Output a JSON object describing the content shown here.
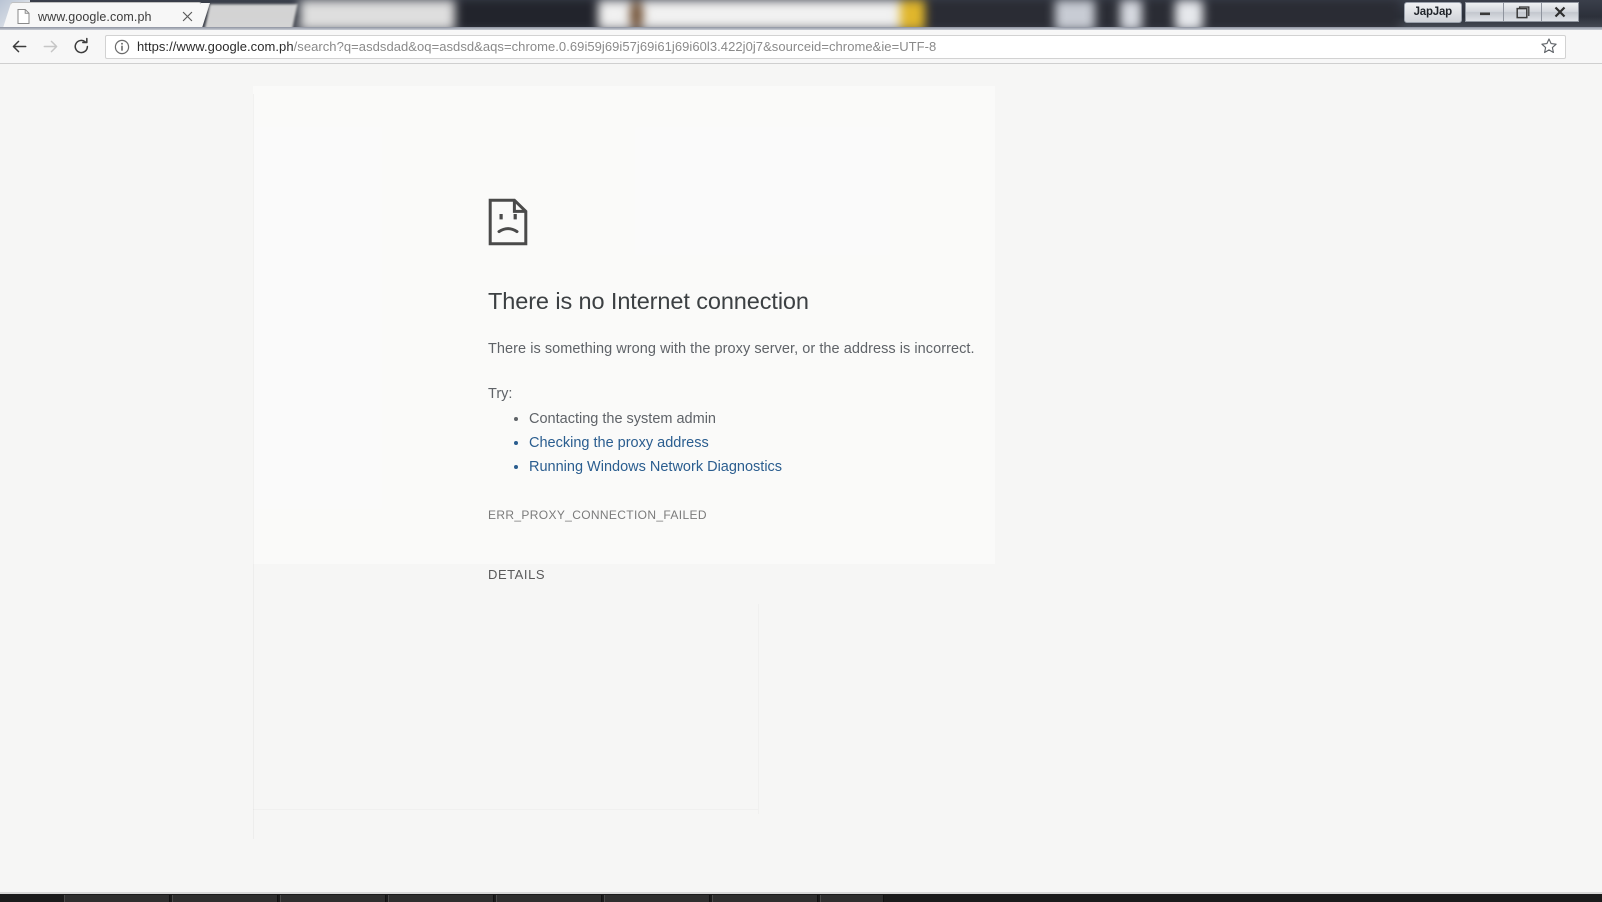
{
  "window": {
    "badge_label": "JapJap",
    "minimize_label": "Minimize",
    "maximize_label": "Restore",
    "close_label": "Close"
  },
  "tabs": [
    {
      "title": "www.google.com.ph",
      "favicon": "page-icon",
      "close": "×",
      "active": true
    }
  ],
  "toolbar": {
    "back_icon": "back-arrow-icon",
    "forward_icon": "forward-arrow-icon",
    "reload_icon": "reload-icon",
    "info_icon": "info-circle-icon",
    "star_icon": "star-outline-icon",
    "menu_icon": "three-dot-menu-icon",
    "url_host": "https://www.google.com.ph",
    "url_path": "/search?q=asdsdad&oq=asdsd&aqs=chrome.0.69i59j69i57j69i61j69i60l3.422j0j7&sourceid=chrome&ie=UTF-8",
    "url_full": "https://www.google.com.ph/search?q=asdsdad&oq=asdsd&aqs=chrome.0.69i59j69i57j69i61j69i60l3.422j0j7&sourceid=chrome&ie=UTF-8"
  },
  "error_page": {
    "icon": "sad-page-icon",
    "title": "There is no Internet connection",
    "subtitle": "There is something wrong with the proxy server, or the address is incorrect.",
    "try_label": "Try:",
    "suggestions": [
      {
        "text": "Contacting the system admin",
        "is_link": false
      },
      {
        "text": "Checking the proxy address",
        "is_link": true
      },
      {
        "text": "Running Windows Network Diagnostics",
        "is_link": true
      }
    ],
    "error_code": "ERR_PROXY_CONNECTION_FAILED",
    "details_button": "DETAILS",
    "link_color": "#2a5d8f",
    "text_color": "#5f6368",
    "background": "#f6f6f5"
  }
}
